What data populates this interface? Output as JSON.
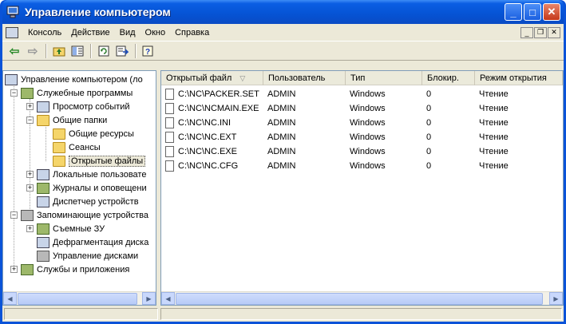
{
  "window": {
    "title": "Управление компьютером",
    "btn_min": "_",
    "btn_max": "□",
    "btn_close": "✕"
  },
  "menu": {
    "items": [
      "Консоль",
      "Действие",
      "Вид",
      "Окно",
      "Справка"
    ]
  },
  "tree": {
    "nodes": [
      {
        "label": "Управление компьютером (ло",
        "icon": "computer-icon"
      },
      {
        "label": "Служебные программы",
        "icon": "tools-icon"
      },
      {
        "label": "Просмотр событий",
        "icon": "event-viewer-icon"
      },
      {
        "label": "Общие папки",
        "icon": "folder-icon"
      },
      {
        "label": "Общие ресурсы",
        "icon": "folder-icon"
      },
      {
        "label": "Сеансы",
        "icon": "folder-icon"
      },
      {
        "label": "Открытые файлы",
        "icon": "folder-icon"
      },
      {
        "label": "Локальные пользовате",
        "icon": "users-icon"
      },
      {
        "label": "Журналы и оповещени",
        "icon": "logs-icon"
      },
      {
        "label": "Диспетчер устройств",
        "icon": "device-manager-icon"
      },
      {
        "label": "Запоминающие устройства",
        "icon": "storage-icon"
      },
      {
        "label": "Съемные ЗУ",
        "icon": "removable-storage-icon"
      },
      {
        "label": "Дефрагментация диска",
        "icon": "defrag-icon"
      },
      {
        "label": "Управление дисками",
        "icon": "disk-management-icon"
      },
      {
        "label": "Службы и приложения",
        "icon": "services-icon"
      }
    ]
  },
  "list": {
    "columns": [
      "Открытый файл",
      "Пользователь",
      "Тип",
      "Блокир.",
      "Режим открытия"
    ],
    "sort_indicator": "▽",
    "rows": [
      [
        "C:\\NC\\PACKER.SET",
        "ADMIN",
        "Windows",
        "0",
        "Чтение"
      ],
      [
        "C:\\NC\\NCMAIN.EXE",
        "ADMIN",
        "Windows",
        "0",
        "Чтение"
      ],
      [
        "C:\\NC\\NC.INI",
        "ADMIN",
        "Windows",
        "0",
        "Чтение"
      ],
      [
        "C:\\NC\\NC.EXT",
        "ADMIN",
        "Windows",
        "0",
        "Чтение"
      ],
      [
        "C:\\NC\\NC.EXE",
        "ADMIN",
        "Windows",
        "0",
        "Чтение"
      ],
      [
        "C:\\NC\\NC.CFG",
        "ADMIN",
        "Windows",
        "0",
        "Чтение"
      ]
    ]
  },
  "colors": {
    "titlebar": "#0553d4",
    "face": "#ece9d8",
    "border": "#7f9db9"
  }
}
